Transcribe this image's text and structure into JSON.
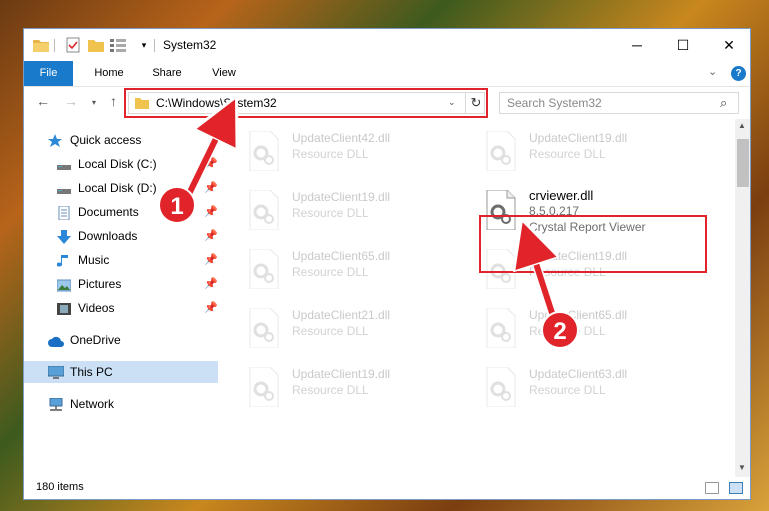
{
  "window": {
    "title": "System32"
  },
  "window_controls": {
    "minimize": "─",
    "maximize": "☐",
    "close": "✕"
  },
  "ribbon": {
    "tabs": [
      {
        "label": "File"
      },
      {
        "label": "Home"
      },
      {
        "label": "Share"
      },
      {
        "label": "View"
      }
    ],
    "expand_glyph": "⌄",
    "help_glyph": "?"
  },
  "nav": {
    "back": "←",
    "forward": "→",
    "recent": "▾",
    "up": "↑",
    "address": "C:\\Windows\\System32",
    "address_dropdown": "⌄",
    "refresh": "↻",
    "search_placeholder": "Search System32",
    "search_icon": "⌕"
  },
  "sidebar": {
    "items": [
      {
        "label": "Quick access",
        "icon": "star-icon"
      },
      {
        "label": "Local Disk (C:)",
        "icon": "drive-icon",
        "pin": "📌"
      },
      {
        "label": "Local Disk (D:)",
        "icon": "drive-icon",
        "pin": "📌"
      },
      {
        "label": "Documents",
        "icon": "documents-icon",
        "pin": "📌"
      },
      {
        "label": "Downloads",
        "icon": "download-icon",
        "pin": "📌"
      },
      {
        "label": "Music",
        "icon": "music-icon",
        "pin": "📌"
      },
      {
        "label": "Pictures",
        "icon": "pictures-icon",
        "pin": "📌"
      },
      {
        "label": "Videos",
        "icon": "videos-icon",
        "pin": "📌"
      },
      {
        "label": "OneDrive",
        "icon": "cloud-icon"
      },
      {
        "label": "This PC",
        "icon": "computer-icon",
        "selected": true
      },
      {
        "label": "Network",
        "icon": "network-icon"
      }
    ]
  },
  "files": [
    {
      "name": "UpdateClient42.dll",
      "desc": "Resource DLL"
    },
    {
      "name": "UpdateClient19.dll",
      "desc": "Resource DLL"
    },
    {
      "name": "UpdateClient19.dll",
      "desc": "Resource DLL"
    },
    {
      "name": "crviewer.dll",
      "version": "8.5.0.217",
      "desc": "Crystal Report Viewer",
      "active": true
    },
    {
      "name": "UpdateClient65.dll",
      "desc": "Resource DLL"
    },
    {
      "name": "UpdateClient19.dll",
      "desc": "Resource DLL"
    },
    {
      "name": "UpdateClient21.dll",
      "desc": "Resource DLL"
    },
    {
      "name": "UpdateClient65.dll",
      "desc": "Resource DLL"
    },
    {
      "name": "UpdateClient19.dll",
      "desc": "Resource DLL"
    },
    {
      "name": "UpdateClient63.dll",
      "desc": "Resource DLL"
    }
  ],
  "status": {
    "count": "180 items"
  },
  "annotations": {
    "badge1": "1",
    "badge2": "2"
  },
  "colors": {
    "accent": "#1979ca",
    "highlight": "#e0242a",
    "selection": "#cce0f5"
  }
}
